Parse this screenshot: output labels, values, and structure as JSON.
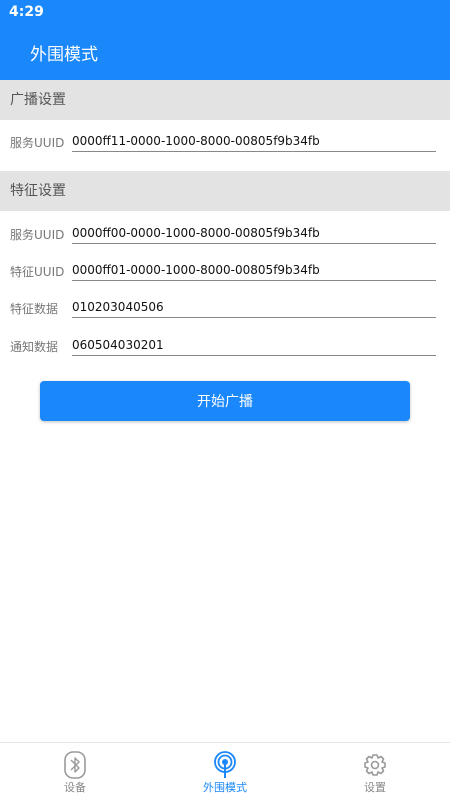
{
  "status_bar": {
    "time": "4:29"
  },
  "app_bar": {
    "title": "外围模式"
  },
  "advertising": {
    "header": "广播设置",
    "service_uuid_label": "服务UUID",
    "service_uuid_value": "0000ff11-0000-1000-8000-00805f9b34fb"
  },
  "characteristic": {
    "header": "特征设置",
    "fields": [
      {
        "label": "服务UUID",
        "value": "0000ff00-0000-1000-8000-00805f9b34fb"
      },
      {
        "label": "特征UUID",
        "value": "0000ff01-0000-1000-8000-00805f9b34fb"
      },
      {
        "label": "特征数据",
        "value": "010203040506"
      },
      {
        "label": "通知数据",
        "value": "060504030201"
      }
    ]
  },
  "actions": {
    "start_label": "开始广播"
  },
  "bottom_nav": {
    "items": [
      {
        "label": "设备",
        "icon": "bluetooth-icon",
        "active": false
      },
      {
        "label": "外围模式",
        "icon": "broadcast-icon",
        "active": true
      },
      {
        "label": "设置",
        "icon": "gear-icon",
        "active": false
      }
    ]
  },
  "colors": {
    "primary": "#1a87fb",
    "section_bg": "#e3e3e3"
  }
}
